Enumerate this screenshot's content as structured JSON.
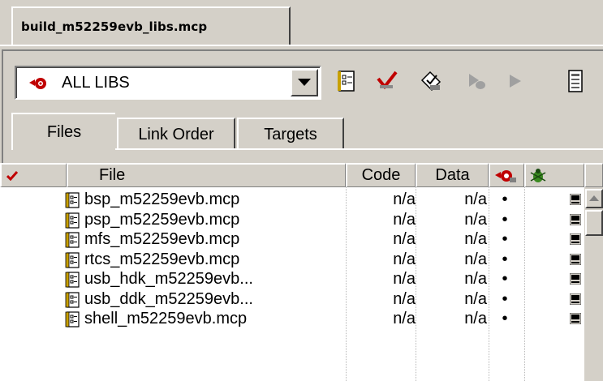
{
  "document_tab": {
    "label": "build_m52259evb_libs.mcp"
  },
  "target": {
    "selected": "ALL LIBS"
  },
  "toolbar": {
    "icons": [
      "settings-icon",
      "check-syntax-icon",
      "make-icon",
      "debug-icon",
      "run-icon",
      "project-inspector-icon"
    ]
  },
  "tabs": [
    {
      "label": "Files",
      "active": true
    },
    {
      "label": "Link Order",
      "active": false
    },
    {
      "label": "Targets",
      "active": false
    }
  ],
  "columns": {
    "check": "✓",
    "file": "File",
    "code": "Code",
    "data": "Data"
  },
  "files": [
    {
      "name": "bsp_m52259evb.mcp",
      "code": "n/a",
      "data": "n/a",
      "target": "•"
    },
    {
      "name": "psp_m52259evb.mcp",
      "code": "n/a",
      "data": "n/a",
      "target": "•"
    },
    {
      "name": "mfs_m52259evb.mcp",
      "code": "n/a",
      "data": "n/a",
      "target": "•"
    },
    {
      "name": "rtcs_m52259evb.mcp",
      "code": "n/a",
      "data": "n/a",
      "target": "•"
    },
    {
      "name": "usb_hdk_m52259evb...",
      "code": "n/a",
      "data": "n/a",
      "target": "•"
    },
    {
      "name": "usb_ddk_m52259evb...",
      "code": "n/a",
      "data": "n/a",
      "target": "•"
    },
    {
      "name": "shell_m52259evb.mcp",
      "code": "n/a",
      "data": "n/a",
      "target": "•"
    }
  ],
  "colors": {
    "face": "#d4d0c8",
    "accent_red": "#c00000",
    "bug_green": "#3a8a20"
  }
}
